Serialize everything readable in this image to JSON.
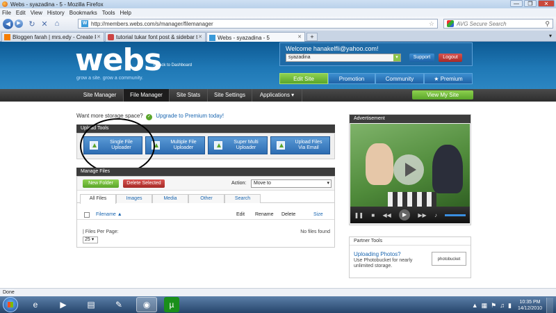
{
  "window": {
    "title": "Webs - syazadina - 5 - Mozilla Firefox",
    "buttons": [
      "—",
      "❐",
      "✕"
    ]
  },
  "menu": [
    "File",
    "Edit",
    "View",
    "History",
    "Bookmarks",
    "Tools",
    "Help"
  ],
  "nav": {
    "url": "http://members.webs.com/s/manager/filemanager",
    "search_placeholder": "AVG Secure Search"
  },
  "tabs": [
    {
      "label": "Bloggen farah | mrs.edy - Create Post"
    },
    {
      "label": "tutorial tukar font post & sidebar tit..."
    },
    {
      "label": "Webs - syazadina - 5"
    }
  ],
  "header": {
    "logo": "webs",
    "tagline": "grow a site. grow a community.",
    "back_dashboard": "« Back to Dashboard",
    "welcome": "Welcome hanakelfli@yahoo.com!",
    "account": "syazadina",
    "support": "Support",
    "logout": "Logout",
    "top_tabs": [
      "Edit Site",
      "Promotion",
      "Community",
      "★ Premium"
    ]
  },
  "subnav": {
    "items": [
      "Site Manager",
      "File Manager",
      "Site Stats",
      "Site Settings",
      "Applications ▾"
    ],
    "view_site": "View My Site"
  },
  "storage": {
    "text": "Want more storage space?",
    "link": "Upgrade to Premium today!"
  },
  "upload": {
    "title": "Upload Tools",
    "buttons": [
      "Single File\nUploader",
      "Multiple File\nUploader",
      "Super Multi\nUploader",
      "Upload Files\nVia Email"
    ]
  },
  "manage": {
    "title": "Manage Files",
    "new_folder": "New Folder",
    "delete_selected": "Delete Selected",
    "action_label": "Action:",
    "action_value": "Move to",
    "tabs": [
      "All Files",
      "Images",
      "Media",
      "Other",
      "Search"
    ],
    "columns": {
      "filename": "Filename ▲",
      "edit": "Edit",
      "rename": "Rename",
      "delete": "Delete",
      "size": "Size"
    },
    "files_per_page": "| Files Per Page:",
    "per_page_value": "25 ▾",
    "no_files": "No files found"
  },
  "ad": {
    "title": "Advertisement"
  },
  "partner": {
    "title": "Partner Tools",
    "link": "Uploading Photos?",
    "desc": "Use Photobucket for nearly unlimited storage.",
    "logo": "photobucket"
  },
  "status": "Done",
  "clock": {
    "time": "10:35 PM",
    "date": "14/12/2010"
  },
  "colors": {
    "header": "#1f78b5",
    "green": "#5aa52a",
    "red": "#a52a27",
    "link": "#1a66b0"
  }
}
